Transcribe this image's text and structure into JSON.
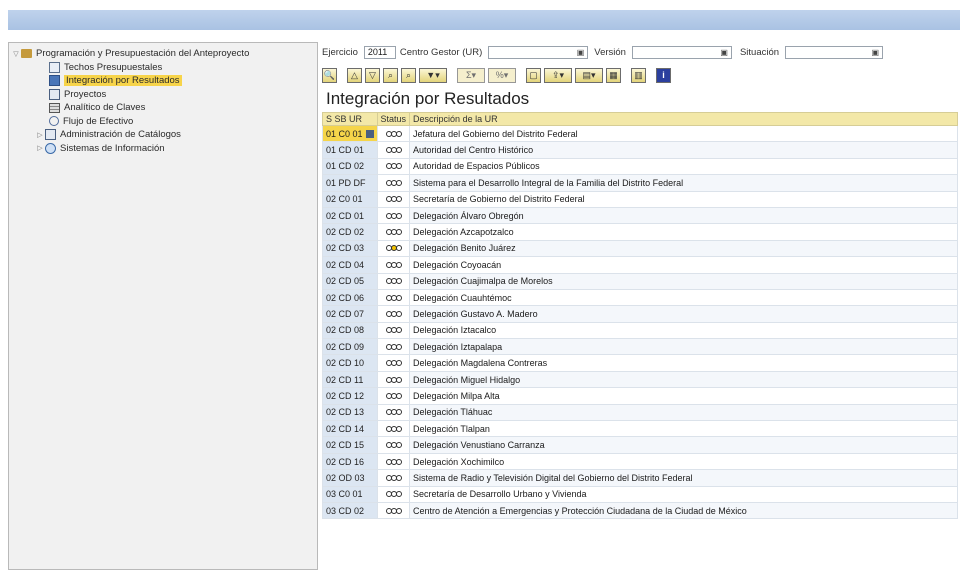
{
  "tree": {
    "root": "Programación y Presupuestación del Anteproyecto",
    "children": [
      "Techos Presupuestales",
      "Integración por Resultados",
      "Proyectos",
      "Analítico de Claves",
      "Flujo de Efectivo"
    ],
    "siblings": [
      "Administración de Catálogos",
      "Sistemas de Información"
    ]
  },
  "filters": {
    "ejercicio_label": "Ejercicio",
    "ejercicio_value": "2011",
    "centro_label": "Centro Gestor (UR)",
    "centro_value": "",
    "version_label": "Versión",
    "version_value": "",
    "situacion_label": "Situación",
    "situacion_value": ""
  },
  "main": {
    "title": "Integración por Resultados"
  },
  "table": {
    "headers": [
      "S SB UR",
      "Status",
      "Descripción de la UR"
    ],
    "rows": [
      {
        "code": "01 C0 01",
        "desc": "Jefatura del Gobierno del Distrito Federal"
      },
      {
        "code": "01 CD 01",
        "desc": "Autoridad del Centro Histórico"
      },
      {
        "code": "01 CD 02",
        "desc": "Autoridad de Espacios Públicos"
      },
      {
        "code": "01 PD DF",
        "desc": "Sistema para el Desarrollo Integral de la Familia del Distrito Federal"
      },
      {
        "code": "02 C0 01",
        "desc": "Secretaría de Gobierno del Distrito Federal"
      },
      {
        "code": "02 CD 01",
        "desc": "Delegación Álvaro Obregón"
      },
      {
        "code": "02 CD 02",
        "desc": "Delegación Azcapotzalco"
      },
      {
        "code": "02 CD 03",
        "desc": "Delegación Benito Juárez"
      },
      {
        "code": "02 CD 04",
        "desc": "Delegación Coyoacán"
      },
      {
        "code": "02 CD 05",
        "desc": "Delegación Cuajimalpa de Morelos"
      },
      {
        "code": "02 CD 06",
        "desc": "Delegación Cuauhtémoc"
      },
      {
        "code": "02 CD 07",
        "desc": "Delegación Gustavo A. Madero"
      },
      {
        "code": "02 CD 08",
        "desc": "Delegación Iztacalco"
      },
      {
        "code": "02 CD 09",
        "desc": "Delegación Iztapalapa"
      },
      {
        "code": "02 CD 10",
        "desc": "Delegación Magdalena Contreras"
      },
      {
        "code": "02 CD 11",
        "desc": "Delegación Miguel Hidalgo"
      },
      {
        "code": "02 CD 12",
        "desc": "Delegación Milpa Alta"
      },
      {
        "code": "02 CD 13",
        "desc": "Delegación Tláhuac"
      },
      {
        "code": "02 CD 14",
        "desc": "Delegación Tlalpan"
      },
      {
        "code": "02 CD 15",
        "desc": "Delegación Venustiano Carranza"
      },
      {
        "code": "02 CD 16",
        "desc": "Delegación Xochimilco"
      },
      {
        "code": "02 OD 03",
        "desc": "Sistema de Radio y Televisión Digital del Gobierno del Distrito Federal"
      },
      {
        "code": "03 C0 01",
        "desc": "Secretaría de Desarrollo Urbano y Vivienda"
      },
      {
        "code": "03 CD 02",
        "desc": "Centro de Atención a Emergencias y Protección Ciudadana de la Ciudad de México"
      }
    ]
  }
}
